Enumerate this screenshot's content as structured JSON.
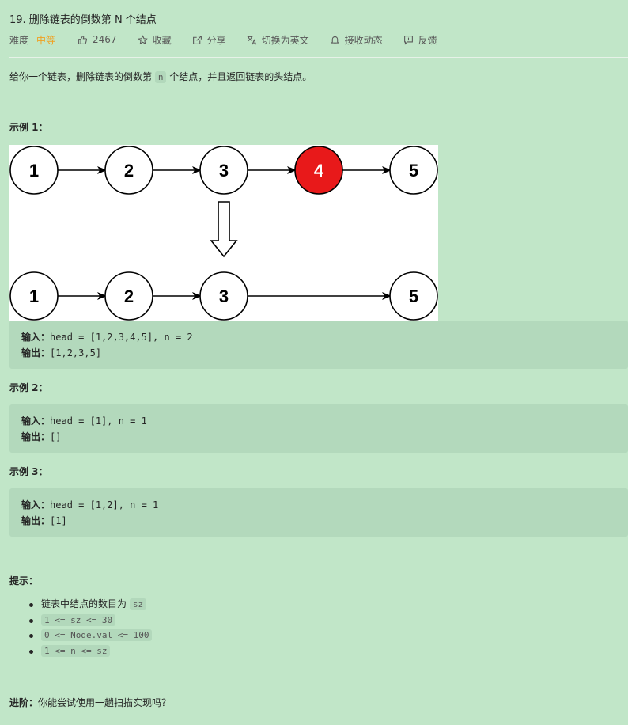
{
  "title": "19. 删除链表的倒数第 N 个结点",
  "meta": {
    "difficulty_label": "难度",
    "difficulty_value": "中等",
    "likes": "2467",
    "favorite": "收藏",
    "share": "分享",
    "switch_lang": "切换为英文",
    "notifications": "接收动态",
    "feedback": "反馈",
    "colors": {
      "difficulty": "#f0a020",
      "highlight_node": "#e8191a"
    }
  },
  "description": {
    "before": "给你一个链表，删除链表的倒数第 ",
    "code": "n",
    "after": " 个结点，并且返回链表的头结点。"
  },
  "examples": [
    {
      "title": "示例 1：",
      "input_label": "输入：",
      "input": "head = [1,2,3,4,5], n = 2",
      "output_label": "输出：",
      "output": "[1,2,3,5]"
    },
    {
      "title": "示例 2：",
      "input_label": "输入：",
      "input": "head = [1], n = 1",
      "output_label": "输出：",
      "output": "[]"
    },
    {
      "title": "示例 3：",
      "input_label": "输入：",
      "input": "head = [1,2], n = 1",
      "output_label": "输出：",
      "output": "[1]"
    }
  ],
  "diagram": {
    "top_nodes": [
      "1",
      "2",
      "3",
      "4",
      "5"
    ],
    "bottom_nodes": [
      "1",
      "2",
      "3",
      "5"
    ],
    "removed_node": "4"
  },
  "tips": {
    "title": "提示：",
    "item1_text": "链表中结点的数目为 ",
    "item1_code": "sz",
    "item2": "1 <= sz <= 30",
    "item3": "0 <= Node.val <= 100",
    "item4": "1 <= n <= sz"
  },
  "followup": {
    "label": "进阶：",
    "text": "你能尝试使用一趟扫描实现吗？"
  }
}
